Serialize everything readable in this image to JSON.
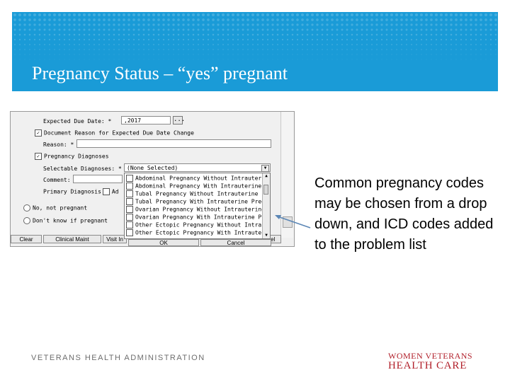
{
  "slide": {
    "title": "Pregnancy Status – “yes” pregnant",
    "note": "Common pregnancy codes may be chosen from a drop down, and ICD codes added to the problem list",
    "footer_left": "VETERANS HEALTH ADMINISTRATION",
    "footer_logo_line1": "WOMEN VETERANS",
    "footer_logo_line2": "HEALTH CARE",
    "colors": {
      "banner": "#1a9bd7",
      "logo": "#b11f2a"
    }
  },
  "form": {
    "due_date_label": "Expected Due Date: *",
    "due_date_value": ",2017",
    "date_picker_label": "...",
    "doc_reason_label": "Document Reason for Expected Due Date Change",
    "reason_label": "Reason: *",
    "reason_value": "",
    "preg_diag_label": "Pregnancy Diagnoses",
    "selectable_label": "Selectable Diagnoses: *",
    "selectable_value": "(None Selected)",
    "comment_label": "Comment:",
    "primary_label": "Primary Diagnosis",
    "primary_trailing": "Ad",
    "no_label": "No, not pregnant",
    "dont_know_label": "Don't know if pregnant",
    "dropdown_items": [
      "Abdominal Pregnancy Without Intrauter:",
      "Abdominal Pregnancy With Intrauterine",
      "Tubal Pregnancy Without Intrauterine P",
      "Tubal Pregnancy With Intrauterine Preg",
      "Ovarian Pregnancy Without Intrauterine",
      "Ovarian Pregnancy With Intrauterine P:",
      "Other Ectopic Pregnancy Without Intrau",
      "Other Ectopic Pregnancy With Intrauter"
    ],
    "buttons": {
      "clear": "Clear",
      "clinical_maint": "Clinical Maint",
      "visit_info": "Visit In",
      "ok": "OK",
      "cancel": "Cancel",
      "cancel_partial": "ncel"
    }
  }
}
